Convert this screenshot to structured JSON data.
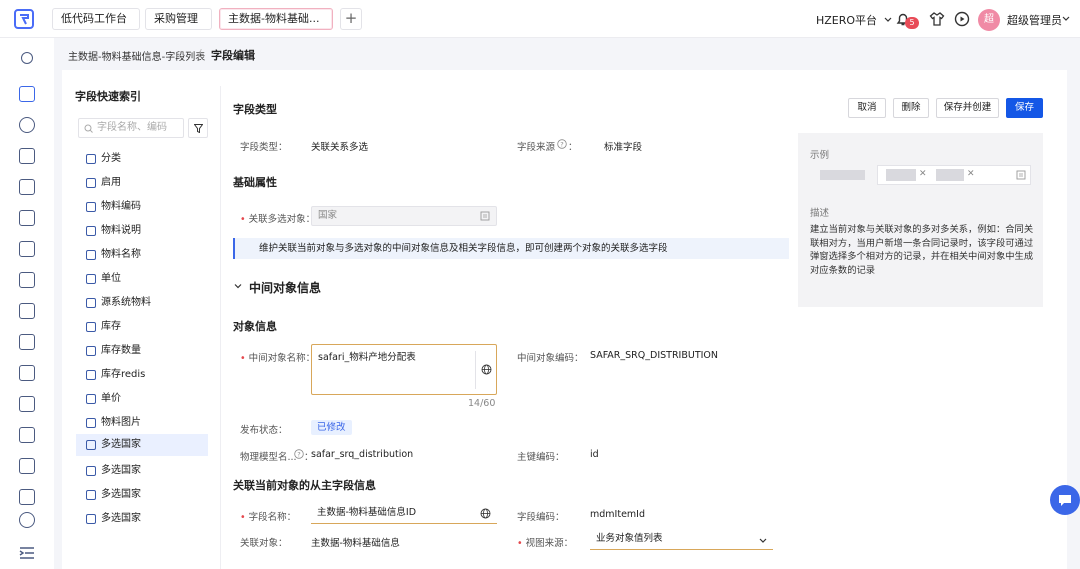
{
  "topbar": {
    "tabs": [
      "低代码工作台",
      "采购管理",
      "主数据-物料基础..."
    ],
    "add_tab": "+",
    "platform": "HZERO平台",
    "notif_count": "5",
    "avatar_text": "超",
    "username": "超级管理员",
    "icons": [
      "logo-icon",
      "bell-icon",
      "shirt-icon",
      "play-icon",
      "chevron-down-icon"
    ]
  },
  "breadcrumb": {
    "parent": "主数据-物料基础信息-字段列表",
    "separator": "/",
    "current": "字段编辑"
  },
  "index": {
    "title": "字段快速索引",
    "search_placeholder": "字段名称、编码",
    "items": [
      "分类",
      "启用",
      "物料编码",
      "物料说明",
      "物料名称",
      "单位",
      "源系统物料",
      "库存",
      "库存数量",
      "库存redis",
      "单价",
      "物料图片",
      "多选国家",
      "多选国家",
      "多选国家",
      "多选国家"
    ],
    "selected_index": 12
  },
  "buttons": {
    "cancel": "取消",
    "delete": "删除",
    "save_create": "保存并创建",
    "save": "保存"
  },
  "field_type": {
    "section": "字段类型",
    "type_label": "字段类型：",
    "type_value": "关联关系多选",
    "source_label": "字段来源",
    "source_value": "标准字段"
  },
  "basic": {
    "section": "基础属性",
    "multi_label": "关联多选对象：",
    "multi_value": "国家",
    "info": "维护关联当前对象与多选对象的中间对象信息及相关字段信息，即可创建两个对象的关联多选字段"
  },
  "middle": {
    "section": "中间对象信息",
    "obj_section": "对象信息",
    "name_label": "中间对象名称：",
    "name_value": "safari_物料产地分配表",
    "name_count": "14/60",
    "code_label": "中间对象编码：",
    "code_value": "SAFAR_SRQ_DISTRIBUTION",
    "publish_label": "发布状态：",
    "publish_value": "已修改",
    "model_label": "物理模型名...",
    "model_value": "safar_srq_distribution",
    "pk_label": "主键编码：",
    "pk_value": "id"
  },
  "related": {
    "section": "关联当前对象的从主字段信息",
    "field_label": "字段名称：",
    "field_value": "主数据-物料基础信息ID",
    "code_label": "字段编码：",
    "code_value": "mdmItemId",
    "obj_label": "关联对象：",
    "obj_value": "主数据-物料基础信息",
    "view_label": "视图来源：",
    "view_value": "业务对象值列表"
  },
  "example": {
    "title": "示例",
    "desc_title": "描述",
    "desc": "建立当前对象与关联对象的多对多关系，例如：合同关联相对方，当用户新增一条合同记录时，该字段可通过弹窗选择多个相对方的记录，并在相关中间对象中生成对应条数的记录"
  }
}
